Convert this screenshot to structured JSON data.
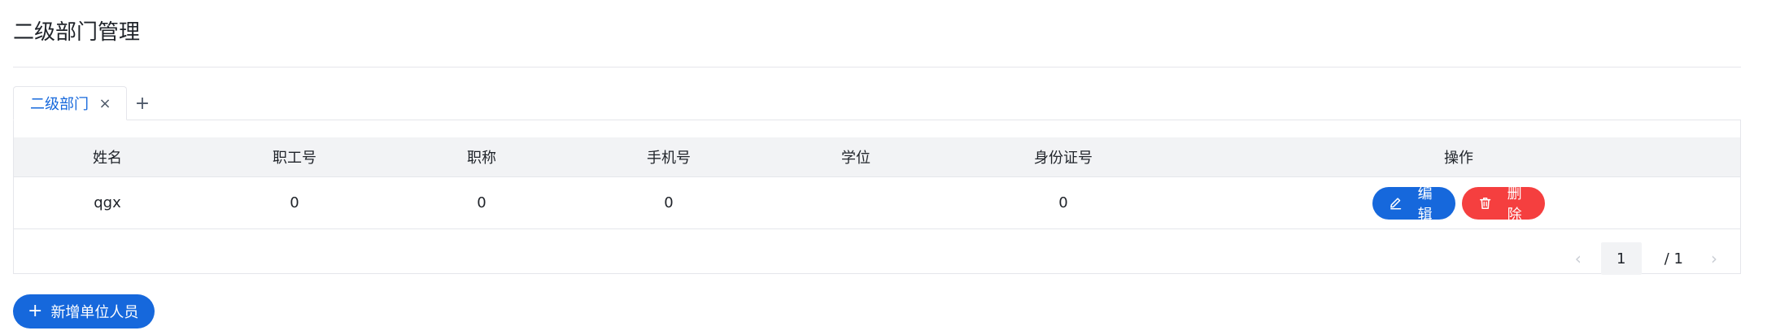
{
  "page": {
    "title": "二级部门管理"
  },
  "tabs": [
    {
      "label": "二级部门",
      "close": "×",
      "active": true
    }
  ],
  "tab_add": "+",
  "table": {
    "headers": [
      "姓名",
      "职工号",
      "职称",
      "手机号",
      "学位",
      "身份证号",
      "操作"
    ],
    "rows": [
      {
        "name": "qgx",
        "staff_no": "0",
        "title": "0",
        "phone": "0",
        "degree": "",
        "id_no": "0"
      }
    ],
    "actions": {
      "edit_label": "编辑",
      "delete_label": "删除"
    }
  },
  "pagination": {
    "prev": "‹",
    "current": "1",
    "total": "/ 1",
    "next": "›"
  },
  "add_button": {
    "icon": "+",
    "label": "新增单位人员"
  },
  "colors": {
    "primary": "#1668dc",
    "danger": "#f53f3f",
    "header_bg": "#f2f3f5",
    "border": "#e5e6eb"
  },
  "icons": {
    "edit": "pencil-icon",
    "delete": "trash-icon",
    "close": "close-icon",
    "add": "plus-icon"
  }
}
